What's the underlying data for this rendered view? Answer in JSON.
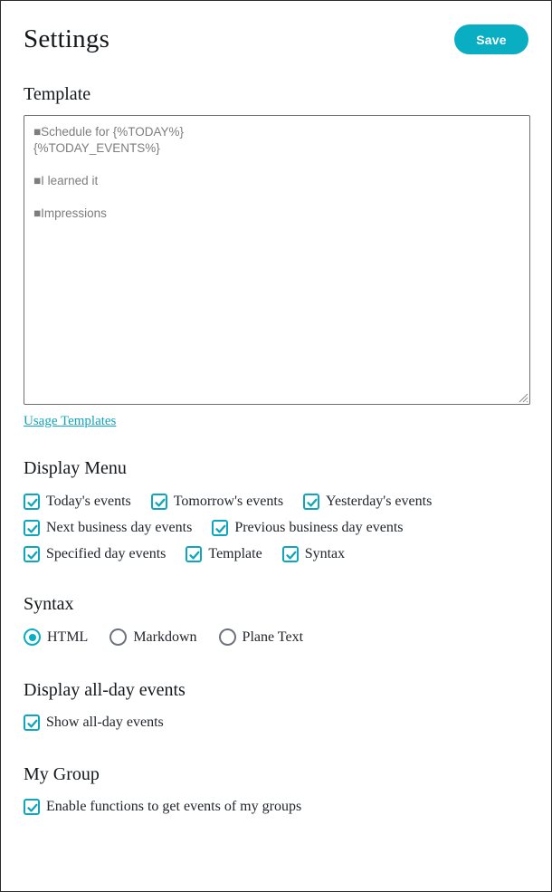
{
  "header": {
    "title": "Settings",
    "save_label": "Save"
  },
  "accent_color": "#09aec3",
  "link_color": "#0fa6bd",
  "template": {
    "heading": "Template",
    "value": "■Schedule for {%TODAY%}\n{%TODAY_EVENTS%}\n\n■I learned it\n\n■Impressions",
    "placeholder": "",
    "usage_link_label": "Usage Templates"
  },
  "display_menu": {
    "heading": "Display Menu",
    "rows": [
      [
        {
          "label": "Today's events",
          "checked": true
        },
        {
          "label": "Tomorrow's events",
          "checked": true
        },
        {
          "label": "Yesterday's events",
          "checked": true
        }
      ],
      [
        {
          "label": "Next business day events",
          "checked": true
        },
        {
          "label": "Previous business day events",
          "checked": true
        }
      ],
      [
        {
          "label": "Specified day events",
          "checked": true
        },
        {
          "label": "Template",
          "checked": true
        },
        {
          "label": "Syntax",
          "checked": true
        }
      ]
    ]
  },
  "syntax": {
    "heading": "Syntax",
    "options": [
      {
        "label": "HTML",
        "selected": true
      },
      {
        "label": "Markdown",
        "selected": false
      },
      {
        "label": "Plane Text",
        "selected": false
      }
    ]
  },
  "all_day_events": {
    "heading": "Display all-day events",
    "option": {
      "label": "Show all-day events",
      "checked": true
    }
  },
  "my_group": {
    "heading": "My Group",
    "option": {
      "label": "Enable functions to get events of my groups",
      "checked": true
    }
  }
}
